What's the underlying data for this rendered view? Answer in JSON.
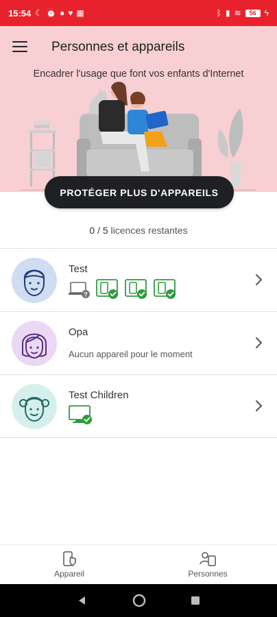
{
  "status_bar": {
    "time": "15:54",
    "battery": "56"
  },
  "header": {
    "title": "Personnes et appareils",
    "subtitle": "Encadrer l'usage que font vos enfants d'Internet"
  },
  "cta": {
    "label": "PROTÉGER PLUS D'APPAREILS"
  },
  "licenses": {
    "count": "0 / 5",
    "label": "licences restantes"
  },
  "people": [
    {
      "name": "Test",
      "avatar_color": "#cfdcf2",
      "icon": "boy-face-icon",
      "devices": [
        "laptop-unknown-icon",
        "tablet-protected-icon",
        "tablet-protected-icon",
        "tablet-protected-icon"
      ]
    },
    {
      "name": "Opa",
      "avatar_color": "#ead8f5",
      "icon": "girl-face-icon",
      "subtitle": "Aucun appareil pour le moment"
    },
    {
      "name": "Test Children",
      "avatar_color": "#d5f0ec",
      "icon": "child-face-icon",
      "devices": [
        "desktop-protected-icon"
      ]
    }
  ],
  "bottom_nav": {
    "device_label": "Appareil",
    "people_label": "Personnes"
  },
  "colors": {
    "brand_red": "#e8222c",
    "hero_pink": "#f8cfd3",
    "protected_green": "#2e9b3f",
    "dark_button": "#1f2023"
  }
}
